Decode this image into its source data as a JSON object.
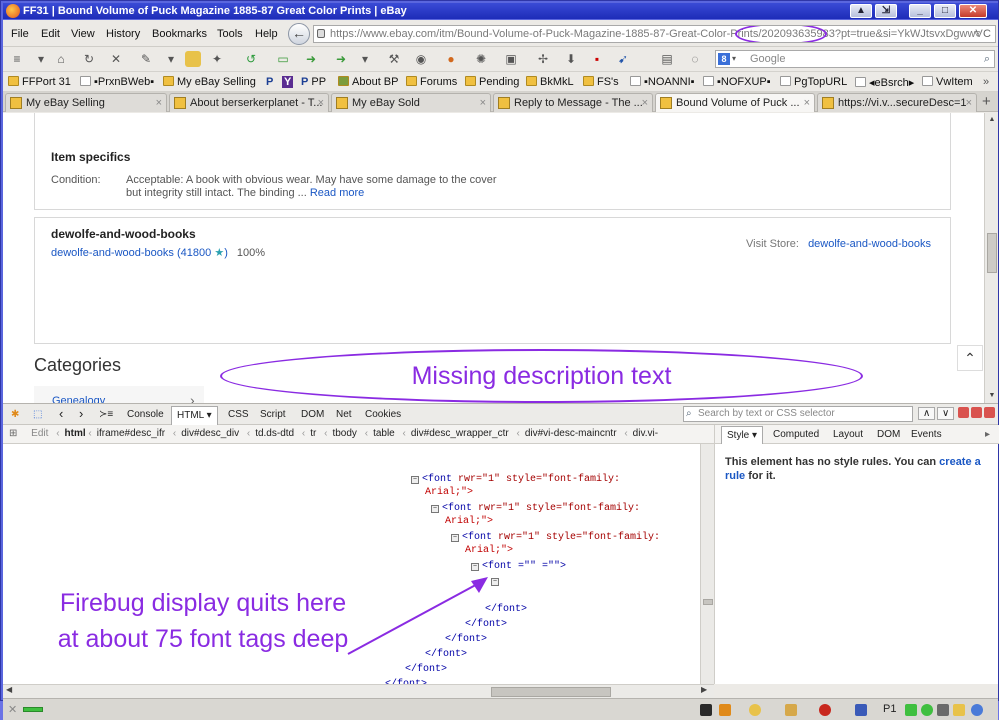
{
  "window": {
    "title": "FF31 | Bound Volume of Puck Magazine 1885-87 Great Color Prints | eBay"
  },
  "menu": [
    "File",
    "Edit",
    "View",
    "History",
    "Bookmarks",
    "Tools",
    "Help"
  ],
  "url": {
    "text": "https://www.ebay.com/itm/Bound-Volume-of-Puck-Magazine-1885-87-Great-Color-Prints/202093635983?pt=true&si=YkWJtsvxDgwwV",
    "end_icons": "▿ C"
  },
  "search": {
    "placeholder": "Google"
  },
  "bookmarks": [
    "FFPort 31",
    "▪PrxnBWeb▪",
    "My eBay Selling",
    "PP",
    "About BP",
    "Forums",
    "Pending",
    "BkMkL",
    "FS's",
    "▪NOANNI▪",
    "▪NOFXUP▪",
    "PgTopURL",
    "◂eBsrch▸",
    "VwItem"
  ],
  "tabs": [
    {
      "label": "My eBay Selling"
    },
    {
      "label": "About berserkerplanet - T..."
    },
    {
      "label": "My eBay Sold"
    },
    {
      "label": "Reply to Message - The ..."
    },
    {
      "label": "Bound Volume of Puck ..."
    },
    {
      "label": "https://vi.v...secureDesc=1"
    }
  ],
  "item_specifics": {
    "heading": "Item specifics",
    "condition_label": "Condition:",
    "condition_line1": "Acceptable: A book with obvious wear. May have some damage to the cover",
    "condition_line2": "but integrity still intact. The binding ...",
    "read_more": "Read more"
  },
  "seller": {
    "heading": "dewolfe-and-wood-books",
    "name": "dewolfe-and-wood-books",
    "score": "(41800",
    "percent": "100%",
    "visit_label": "Visit Store:",
    "store": "dewolfe-and-wood-books"
  },
  "categories": {
    "heading": "Categories",
    "item": "Genealogy",
    "chevron": "›"
  },
  "annotation_top": "Missing description text",
  "annotation_bottom": "Firebug display quits here at about 75 font tags deep",
  "firebug": {
    "panels": [
      "Console",
      "HTML ▾",
      "CSS",
      "Script",
      "DOM",
      "Net",
      "Cookies"
    ],
    "search_placeholder": "Search by text or CSS selector",
    "edit": "Edit",
    "crumbs": [
      "html",
      "iframe#desc_ifr",
      "div#desc_div",
      "td.ds-dtd",
      "tr",
      "tbody",
      "table",
      "div#desc_wrapper_ctr",
      "div#vi-desc-maincntr",
      "div.vi-"
    ],
    "side_tabs": [
      "Style ▾",
      "Computed",
      "Layout",
      "DOM",
      "Events"
    ],
    "side_message_1": "This element has no style rules. You can ",
    "side_link": "create a rule",
    "side_message_2": " for it.",
    "code": {
      "open_tag": "<font",
      "attr1": " rwr=\"1\"",
      "attr2": " style=\"font-family:",
      "cont": "Arial;\">",
      "empty_open": "<font =\"\" =\"\">",
      "close": "</font>"
    }
  },
  "status": {
    "left": "✕",
    "right": "P1"
  }
}
